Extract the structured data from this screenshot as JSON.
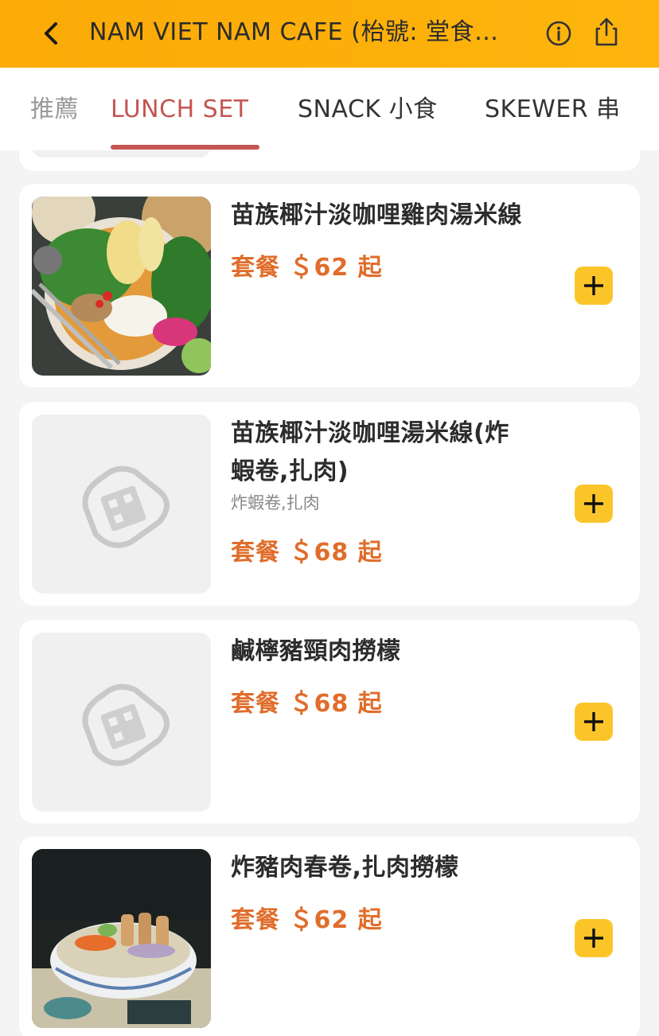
{
  "header": {
    "title": "NAM VIET NAM CAFE (枱號: 堂食…"
  },
  "tabs": [
    {
      "label": "推薦"
    },
    {
      "label": "LUNCH SET"
    },
    {
      "label": "SNACK 小食"
    },
    {
      "label": "SKEWER 串"
    }
  ],
  "active_tab": "LUNCH SET",
  "colors": {
    "header": "#fbaa06",
    "active_tab": "#c45552",
    "price": "#e06d2b",
    "add_button": "#fbc52a"
  },
  "items": [
    {
      "name": "苗族椰汁淡咖哩雞肉湯米線",
      "price": "套餐 ＄62 起",
      "image": "food-photo"
    },
    {
      "name_line1": "苗族椰汁淡咖哩湯米線(炸",
      "name_line2": "蝦卷,扎肉)",
      "desc": "炸蝦卷,扎肉",
      "price": "套餐 ＄68 起",
      "image": "placeholder"
    },
    {
      "name": "鹹檸豬頸肉撈檬",
      "price": "套餐 ＄68 起",
      "image": "placeholder"
    },
    {
      "name": "炸豬肉春卷,扎肉撈檬",
      "price": "套餐 ＄62 起",
      "image": "food-photo"
    }
  ]
}
